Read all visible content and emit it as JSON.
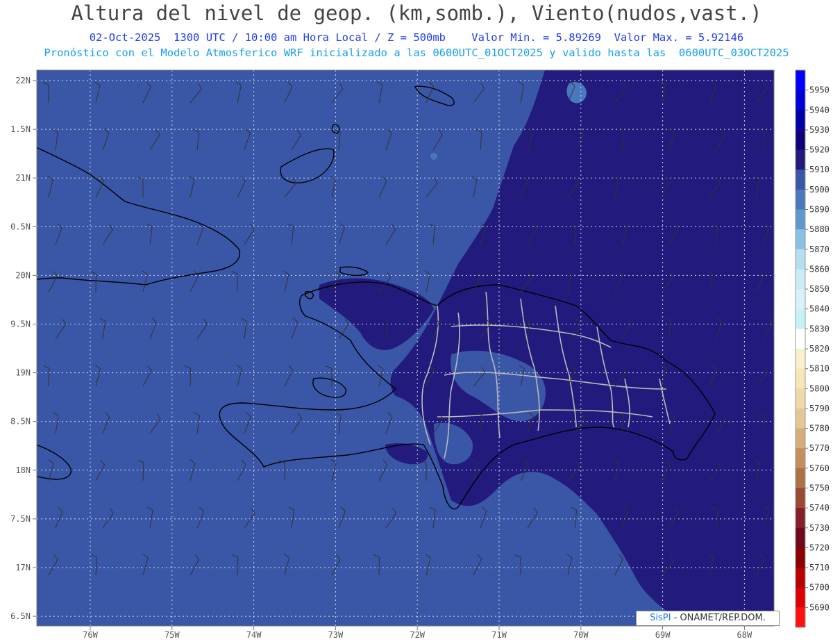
{
  "header": {
    "title": "Altura del nivel de geop. (km,somb.), Viento(nudos,vast.)",
    "subtitle_line1": "02-Oct-2025  1300 UTC / 10:00 am Hora Local / Z = 500mb    Valor Min. = 5.89269  Valor Max. = 5.92146",
    "subtitle_line2": "Pronóstico con el Modelo Atmosferico WRF inicializado a las 0600UTC_01OCT2025 y valido hasta las  0600UTC_03OCT2025"
  },
  "axes": {
    "lat_labels": [
      "22N",
      "1.5N",
      "21N",
      "0.5N",
      "20N",
      "9.5N",
      "19N",
      "8.5N",
      "18N",
      "7.5N",
      "17N",
      "6.5N"
    ],
    "lon_labels": [
      "76W",
      "75W",
      "74W",
      "73W",
      "72W",
      "71W",
      "70W",
      "69W",
      "68W"
    ]
  },
  "colorbar": {
    "labels": [
      "5950",
      "5940",
      "5930",
      "5920",
      "5910",
      "5900",
      "5890",
      "5880",
      "5870",
      "5860",
      "5850",
      "5840",
      "5830",
      "5820",
      "5810",
      "5800",
      "5790",
      "5780",
      "5770",
      "5760",
      "5750",
      "5740",
      "5730",
      "5720",
      "5710",
      "5700",
      "5690"
    ],
    "colors": [
      "#0000ff",
      "#0000d8",
      "#0000a8",
      "#10007a",
      "#221b7d",
      "#3a56a6",
      "#4a78be",
      "#5f98cf",
      "#8cc0e2",
      "#b3dff0",
      "#c9ecf6",
      "#d8f2f8",
      "#c6f2f7",
      "#ffffff",
      "#f9f1cc",
      "#f6e6b8",
      "#f0d9a8",
      "#e5c795",
      "#d5ad7a",
      "#c48f5c",
      "#b07045",
      "#9a4a33",
      "#861f2a",
      "#6f0818",
      "#8a0000",
      "#b80000",
      "#dc0000",
      "#ff1010"
    ],
    "colors_note_unused": ""
  },
  "legend_fill": {
    "base_color": "#3a56a6",
    "high_color": "#221b7d",
    "light_color": "#4a78be"
  },
  "credit": {
    "brand": "SisPI",
    "text": " - ONAMET/REP.DOM."
  }
}
